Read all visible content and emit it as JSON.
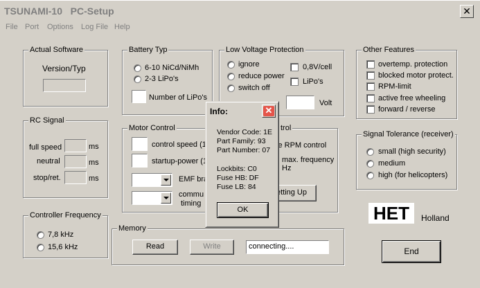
{
  "window": {
    "title": "TSUNAMI-10   PC-Setup",
    "close_glyph": "✕"
  },
  "menu": [
    "File",
    "Port",
    "Options",
    "Log File",
    "Help"
  ],
  "actual_software": {
    "title": "Actual Software",
    "label": "Version/Typ",
    "value": ""
  },
  "battery": {
    "title": "Battery Typ",
    "opt1": "6-10 NiCd/NiMh",
    "opt2": "2-3 LiPo's",
    "lipo_count_label": "Number of LiPo's"
  },
  "low_voltage": {
    "title": "Low Voltage Protection",
    "ignore": "ignore",
    "reduce": "reduce power",
    "switch_off": "switch off",
    "per_cell": "0,8V/cell",
    "lipos": "LiPo's",
    "volt_unit": "Volt",
    "volt_value": ""
  },
  "other_features": {
    "title": "Other Features",
    "items": [
      "overtemp. protection",
      "blocked motor protect.",
      "RPM-limit",
      "active free wheeling",
      "forward / reverse"
    ]
  },
  "rc_signal": {
    "title": "RC Signal",
    "full_speed": "full speed",
    "neutral": "neutral",
    "stop": "stop/ret.",
    "unit": "ms"
  },
  "motor_control": {
    "title": "Motor Control",
    "control_speed": "control speed (1",
    "startup_power": "startup-power (1",
    "emf": "EMF bra",
    "commu": "commu",
    "timing": "timing"
  },
  "rpm_control": {
    "title": "trol",
    "rpm_label": "ve RPM control",
    "max_freq": "max. frequency",
    "hz": "Hz",
    "setting_up": "etting Up"
  },
  "signal_tolerance": {
    "title": "Signal Tolerance (receiver)",
    "small": "small (high security)",
    "medium": "medium",
    "high": "high (for helicopters)"
  },
  "controller_frequency": {
    "title": "Controller Frequency",
    "f1": "7,8 kHz",
    "f2": "15,6 kHz"
  },
  "memory": {
    "title": "Memory",
    "read": "Read",
    "write": "Write",
    "status": "connecting...."
  },
  "brand": {
    "logo": "HET",
    "country": "Holland"
  },
  "end_button": "End",
  "info_dialog": {
    "title": "Info:",
    "vendor_code": "Vendor Code: 1E",
    "part_family": "Part Family: 93",
    "part_number": "Part Number: 07",
    "lockbits": "Lockbits: C0",
    "fuse_hb": "Fuse HB: DF",
    "fuse_lb": "Fuse LB: 84",
    "ok": "OK"
  }
}
